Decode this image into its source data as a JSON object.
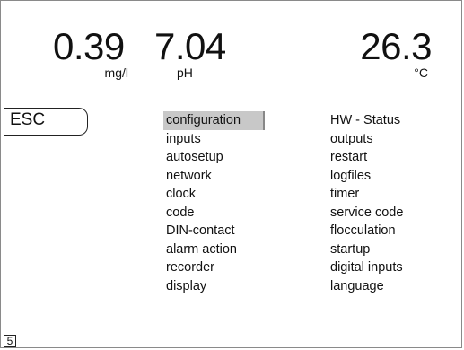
{
  "readings": {
    "oxygen": {
      "value": "0.39",
      "unit": "mg/l"
    },
    "ph": {
      "value": "7.04",
      "unit": "pH"
    },
    "temperature": {
      "value": "26.3",
      "unit": "°C"
    }
  },
  "esc_label": "ESC",
  "menu": {
    "selected": "configuration",
    "left": [
      "configuration",
      "inputs",
      "autosetup",
      "network",
      "clock",
      "code",
      "DIN-contact",
      "alarm action",
      "recorder",
      "display"
    ],
    "right": [
      "HW - Status",
      "outputs",
      "restart",
      "logfiles",
      "timer",
      "service code",
      "flocculation",
      "startup",
      "digital inputs",
      "language"
    ]
  },
  "page_number": "5"
}
